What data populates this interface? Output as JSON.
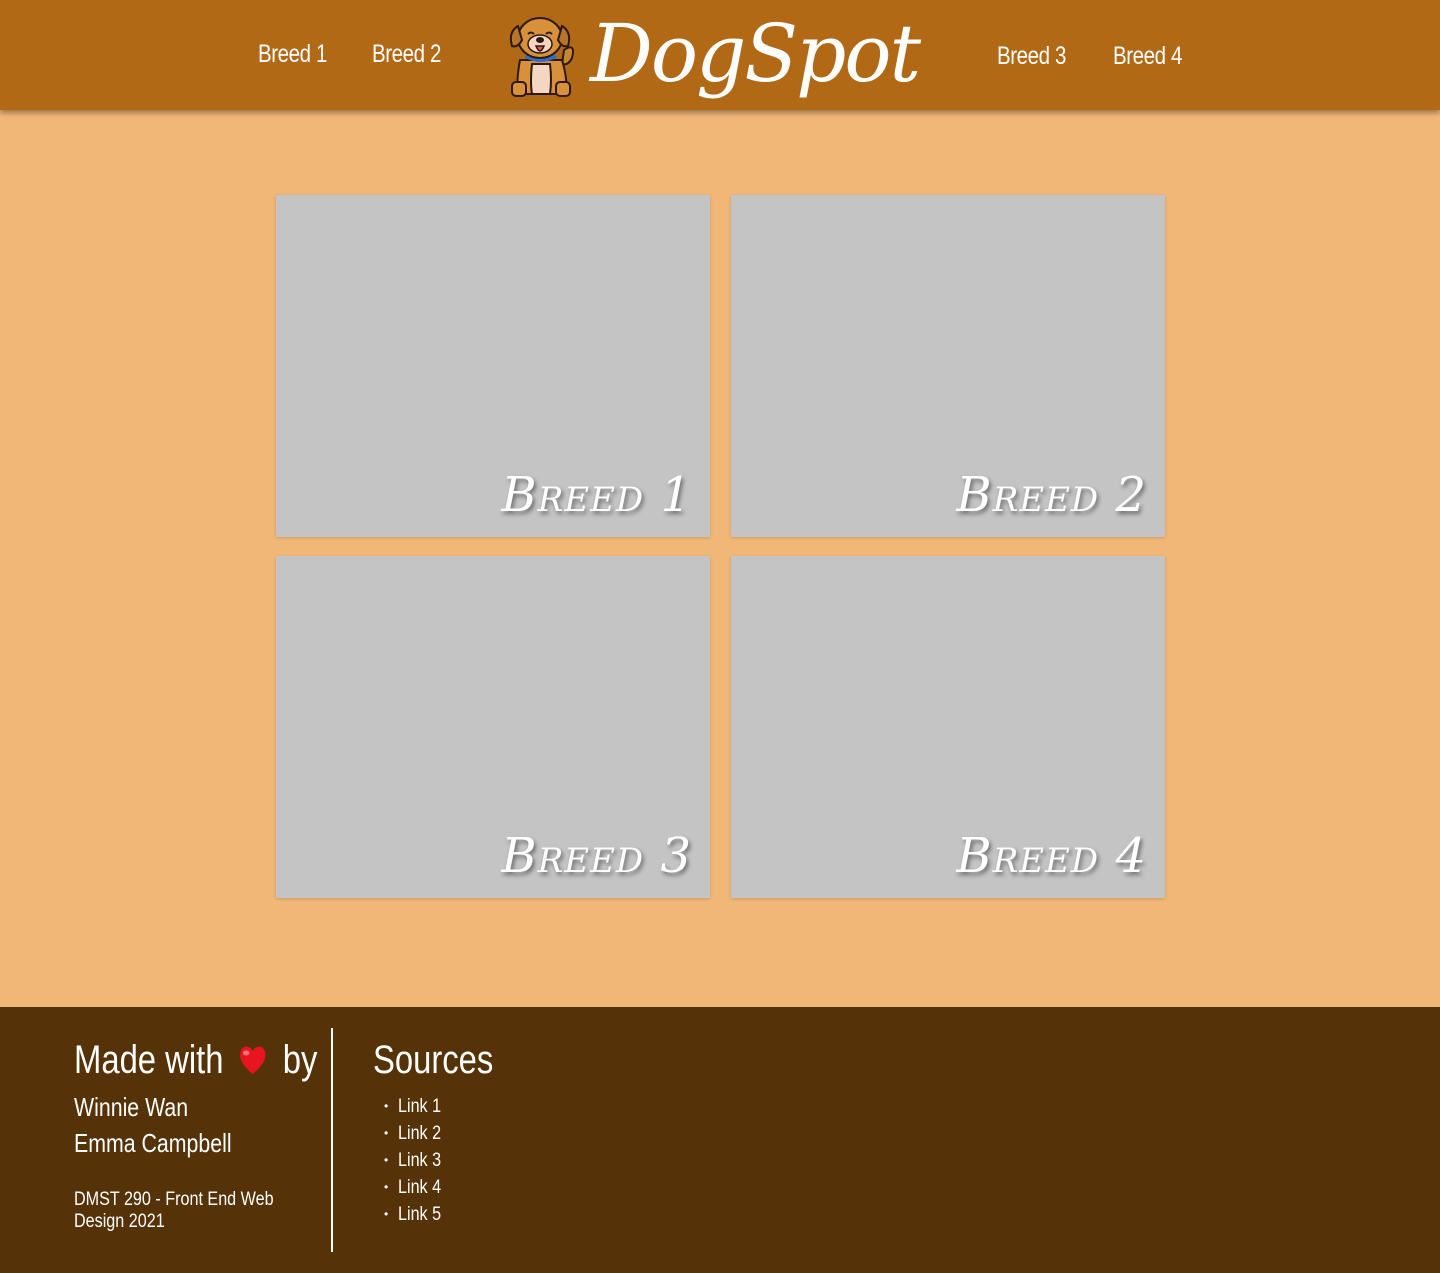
{
  "header": {
    "brand": "DogSpot",
    "nav_left": [
      {
        "label": "Breed 1"
      },
      {
        "label": "Breed 2"
      }
    ],
    "nav_right": [
      {
        "label": "Breed 3"
      },
      {
        "label": "Breed 4"
      }
    ],
    "logo_icon": "dog-icon"
  },
  "cards": [
    {
      "label": "Breed 1"
    },
    {
      "label": "Breed 2"
    },
    {
      "label": "Breed 3"
    },
    {
      "label": "Breed 4"
    }
  ],
  "footer": {
    "made_with_prefix": "Made with",
    "made_with_suffix": "by",
    "heart_icon": "heart-icon",
    "authors": [
      "Winnie Wan",
      "Emma Campbell"
    ],
    "course": "DMST 290 - Front End Web Design 2021",
    "sources_title": "Sources",
    "sources": [
      {
        "label": "Link 1"
      },
      {
        "label": "Link 2"
      },
      {
        "label": "Link 3"
      },
      {
        "label": "Link 4"
      },
      {
        "label": "Link 5"
      }
    ]
  },
  "colors": {
    "header_bg": "#b16915",
    "page_bg": "#f0b777",
    "card_bg": "#c4c4c4",
    "footer_bg": "#553207",
    "text": "#ffffff"
  }
}
